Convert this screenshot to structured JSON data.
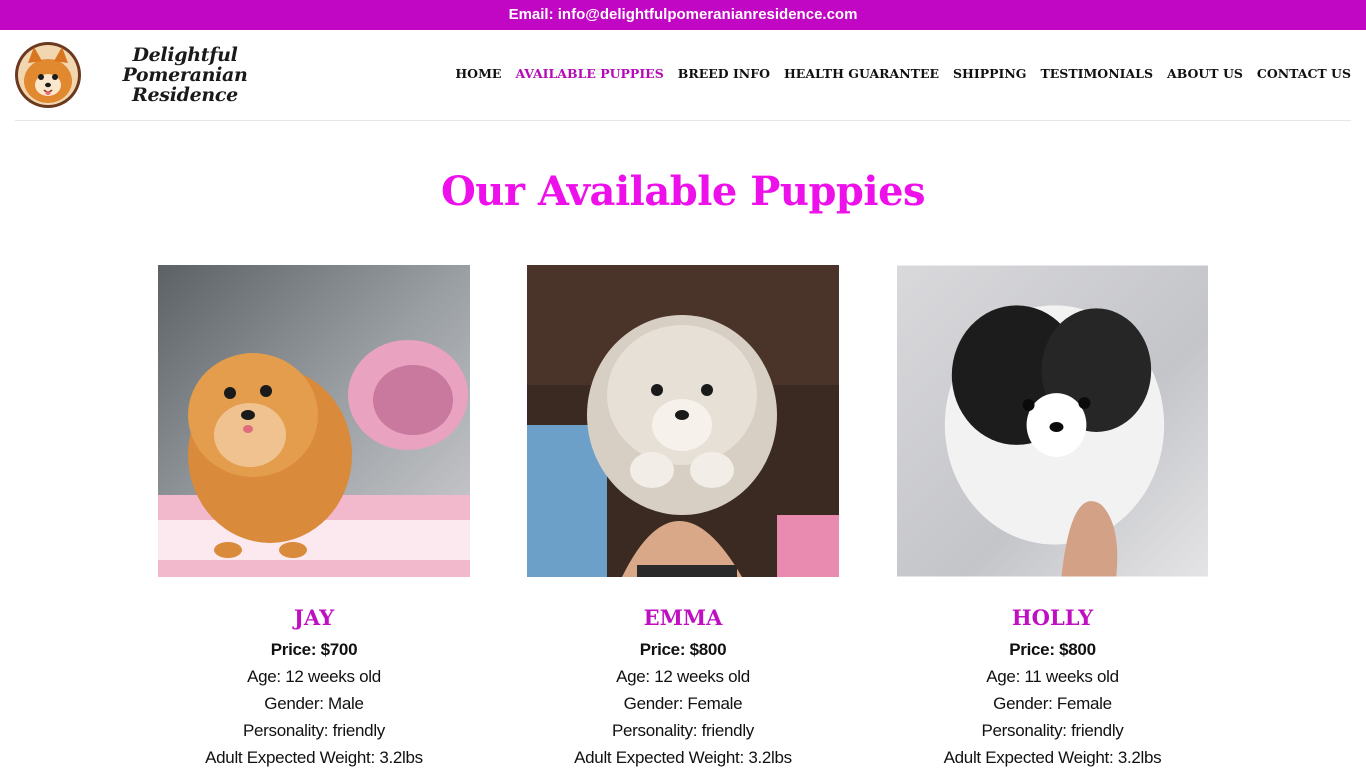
{
  "topbar": {
    "email_text": "Email: info@delightfulpomeranianresidence.com"
  },
  "logo": {
    "line1": "Delightful Pomeranian",
    "line2": "Residence",
    "icon": "pomeranian-logo-icon"
  },
  "nav": {
    "items": [
      {
        "label": "HOME",
        "active": false
      },
      {
        "label": "AVAILABLE PUPPIES",
        "active": true
      },
      {
        "label": "BREED INFO",
        "active": false
      },
      {
        "label": "HEALTH GUARANTEE",
        "active": false
      },
      {
        "label": "SHIPPING",
        "active": false
      },
      {
        "label": "TESTIMONIALS",
        "active": false
      },
      {
        "label": "ABOUT US",
        "active": false
      },
      {
        "label": "CONTACT US",
        "active": false
      }
    ]
  },
  "page": {
    "title": "Our Available Puppies"
  },
  "colors": {
    "accent": "#c106c4",
    "title": "#ee10ea",
    "name": "#bf0fc1"
  },
  "puppies": [
    {
      "name": "JAY",
      "price": "Price: $700",
      "age": "Age: 12 weeks old",
      "gender": "Gender: Male",
      "personality": "Personality: friendly",
      "weight": "Adult Expected Weight: 3.2lbs"
    },
    {
      "name": "EMMA",
      "price": "Price: $800",
      "age": "Age: 12 weeks old",
      "gender": "Gender: Female",
      "personality": "Personality: friendly",
      "weight": "Adult Expected Weight: 3.2lbs"
    },
    {
      "name": "HOLLY",
      "price": "Price: $800",
      "age": "Age: 11 weeks old",
      "gender": "Gender: Female",
      "personality": "Personality: friendly",
      "weight": "Adult Expected Weight: 3.2lbs"
    }
  ]
}
